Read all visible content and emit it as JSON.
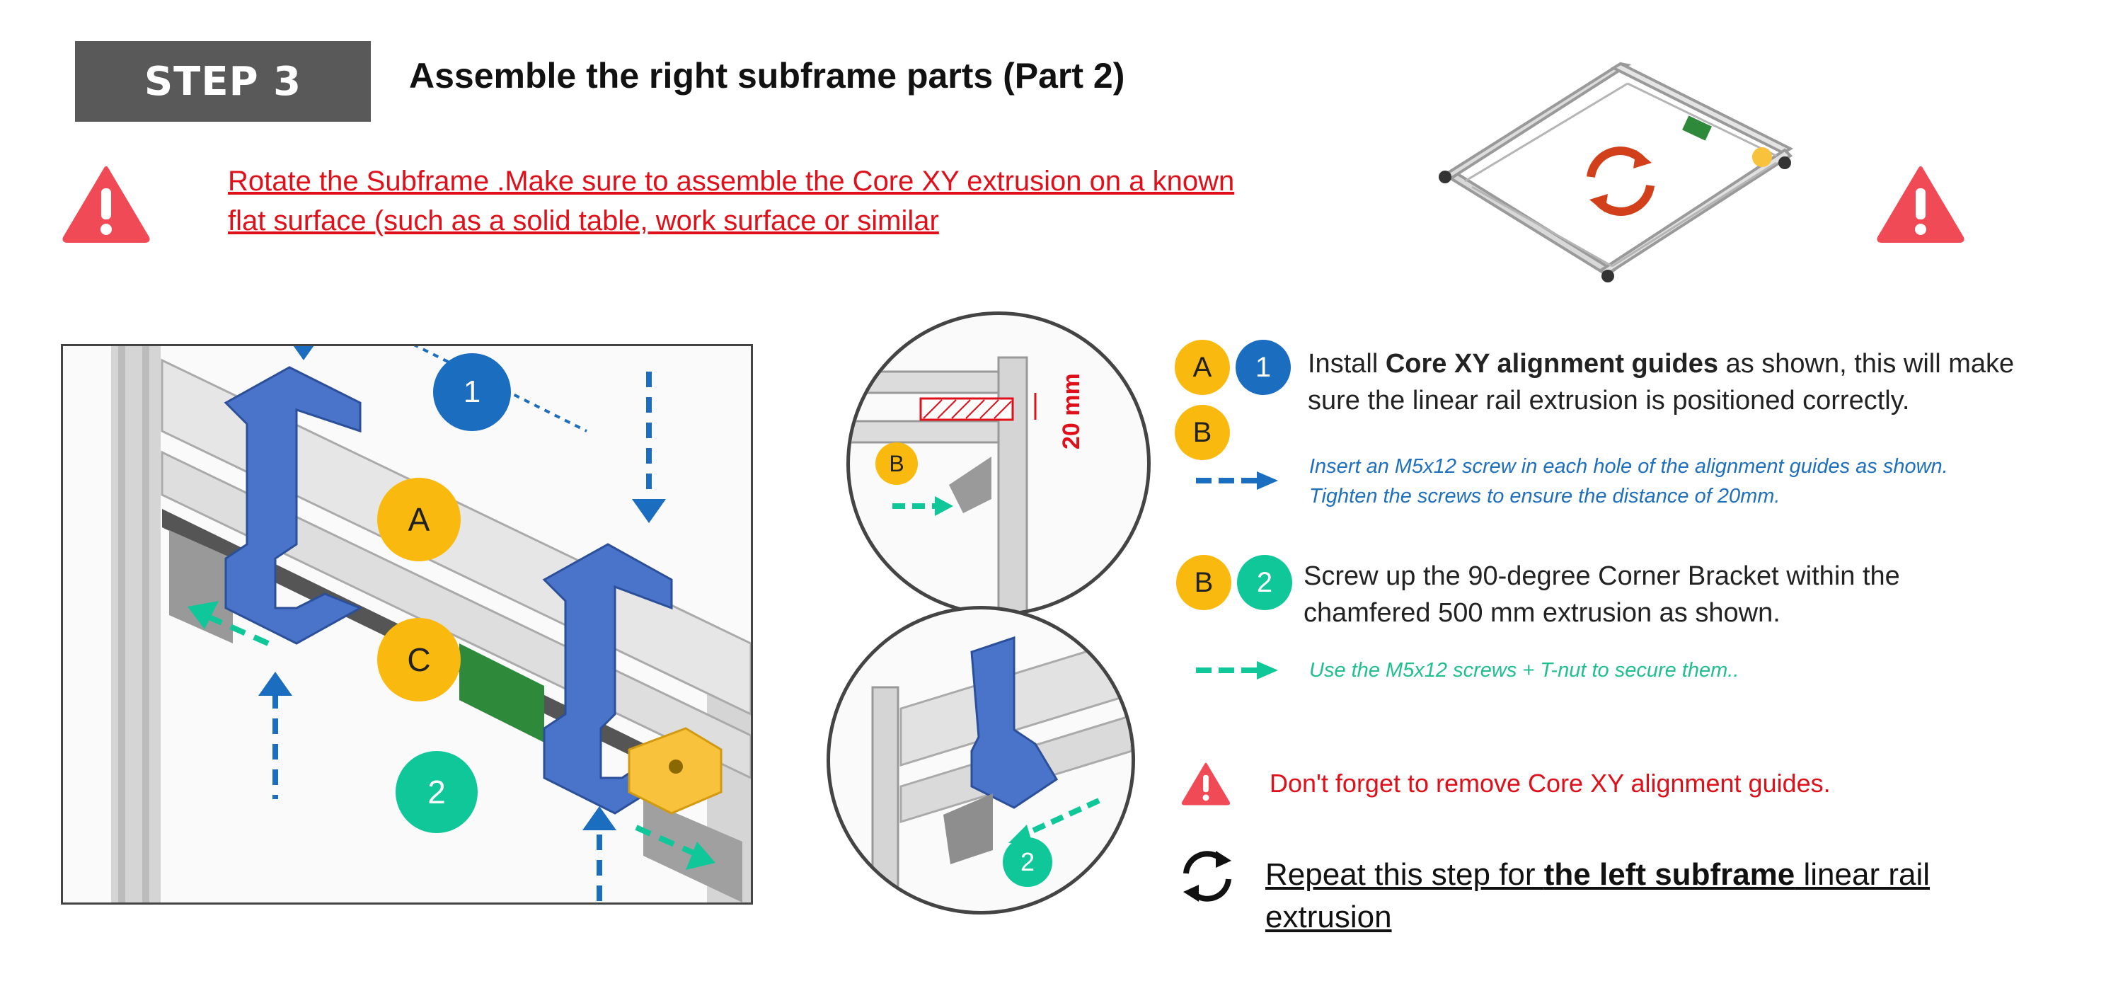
{
  "step": {
    "label": "STEP 3"
  },
  "title": "Assemble the right subframe parts (Part 2)",
  "warning": {
    "line1": "Rotate the Subframe .Make sure to assemble the Core XY extrusion  on a known",
    "line2": "flat surface (such as a solid table, work surface or similar"
  },
  "labels": {
    "A": "A",
    "B": "B",
    "C": "C",
    "one": "1",
    "two": "2",
    "dimension": "20 mm"
  },
  "instructions": {
    "install_pre": "Install ",
    "install_bold": "Core XY alignment guides",
    "install_post": " as shown, this will make",
    "install_line2": "sure the linear rail extrusion is positioned correctly.",
    "blue_note_1": "Insert an M5x12 screw in each hole of the alignment guides as shown.",
    "blue_note_2": "Tighten the screws to  ensure the distance of 20mm.",
    "screw_line1": "Screw up the  90-degree Corner Bracket  within the",
    "screw_line2": "chamfered 500 mm extrusion as shown.",
    "green_note": "Use the M5x12 screws + T-nut to secure them..",
    "remove_note": "Don't forget to remove Core XY alignment guides.",
    "repeat_pre": "Repeat this step for ",
    "repeat_bold": "the left subframe",
    "repeat_post": " linear rail",
    "repeat_line2": "extrusion"
  },
  "icons": [
    "warning-icon",
    "rotate-icon",
    "arrow-icon"
  ],
  "colors": {
    "step_bg": "#595959",
    "warning_red": "#e0101a",
    "badge_yellow": "#f9b90f",
    "badge_blue": "#1a6dbf",
    "badge_green": "#10c79a",
    "part_blue": "#4a74c9",
    "rotate_orange": "#d1401a"
  }
}
